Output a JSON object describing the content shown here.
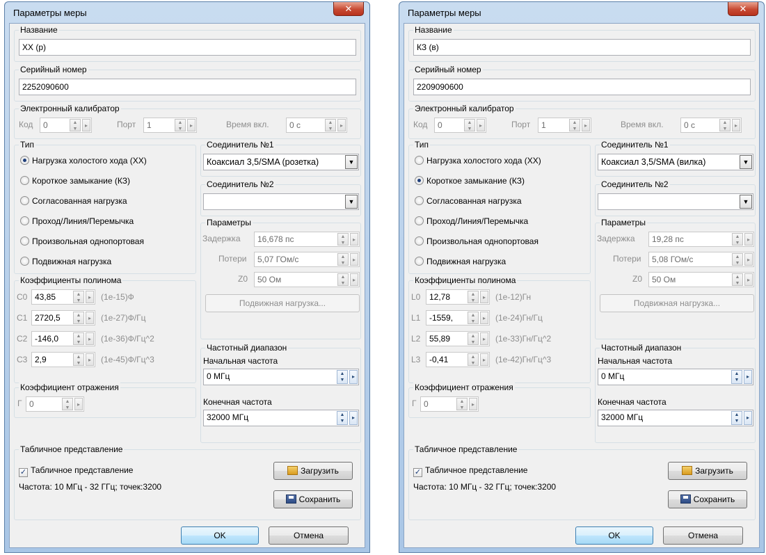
{
  "dialogs": [
    {
      "title": "Параметры меры",
      "close_glyph": "✕",
      "name_group": {
        "title": "Название",
        "value": "XX (p)"
      },
      "serial_group": {
        "title": "Серийный номер",
        "value": "2252090600"
      },
      "ecal": {
        "title": "Электронный калибратор",
        "code_label": "Код",
        "code_value": "0",
        "port_label": "Порт",
        "port_value": "1",
        "time_label": "Время вкл.",
        "time_value": "0 с"
      },
      "type": {
        "title": "Тип",
        "options": [
          "Нагрузка холостого хода (XX)",
          "Короткое замыкание (КЗ)",
          "Согласованная нагрузка",
          "Проход/Линия/Перемычка",
          "Произвольная однопортовая",
          "Подвижная нагрузка"
        ],
        "selected": 0
      },
      "conn1": {
        "title": "Соединитель №1",
        "value": "Коаксиал 3,5/SMA (розетка)"
      },
      "conn2": {
        "title": "Соединитель №2",
        "value": ""
      },
      "params": {
        "title": "Параметры",
        "delay_label": "Задержка",
        "delay_value": "16,678 пс",
        "loss_label": "Потери",
        "loss_value": "5,07 ГОм/с",
        "z0_label": "Z0",
        "z0_value": "50 Ом",
        "sliding_button": "Подвижная нагрузка..."
      },
      "poly": {
        "title": "Коэффициенты полинома",
        "rows": [
          {
            "label": "C0",
            "value": "43,85",
            "unit": "(1e-15)Ф"
          },
          {
            "label": "C1",
            "value": "2720,5",
            "unit": "(1e-27)Ф/Гц"
          },
          {
            "label": "C2",
            "value": "-146,0",
            "unit": "(1e-36)Ф/Гц^2"
          },
          {
            "label": "C3",
            "value": "2,9",
            "unit": "(1e-45)Ф/Гц^3"
          }
        ]
      },
      "reflection": {
        "title": "Коэффициент отражения",
        "label": "Г",
        "value": "0"
      },
      "freq": {
        "title": "Частотный диапазон",
        "start_label": "Начальная частота",
        "start_value": "0 МГц",
        "stop_label": "Конечная  частота",
        "stop_value": "32000 МГц"
      },
      "table": {
        "title": "Табличное представление",
        "checkbox_label": "Табличное представление",
        "checked": true,
        "info": "Частота: 10 МГц - 32 ГГц; точек:3200",
        "load_button": "Загрузить",
        "save_button": "Сохранить"
      },
      "ok_button": "OK",
      "cancel_button": "Отмена"
    },
    {
      "title": "Параметры меры",
      "close_glyph": "✕",
      "name_group": {
        "title": "Название",
        "value": "КЗ (в)"
      },
      "serial_group": {
        "title": "Серийный номер",
        "value": "2209090600"
      },
      "ecal": {
        "title": "Электронный калибратор",
        "code_label": "Код",
        "code_value": "0",
        "port_label": "Порт",
        "port_value": "1",
        "time_label": "Время вкл.",
        "time_value": "0 с"
      },
      "type": {
        "title": "Тип",
        "options": [
          "Нагрузка холостого хода (XX)",
          "Короткое замыкание (КЗ)",
          "Согласованная нагрузка",
          "Проход/Линия/Перемычка",
          "Произвольная однопортовая",
          "Подвижная нагрузка"
        ],
        "selected": 1
      },
      "conn1": {
        "title": "Соединитель №1",
        "value": "Коаксиал 3,5/SMA (вилка)"
      },
      "conn2": {
        "title": "Соединитель №2",
        "value": ""
      },
      "params": {
        "title": "Параметры",
        "delay_label": "Задержка",
        "delay_value": "19,28 пс",
        "loss_label": "Потери",
        "loss_value": "5,08 ГОм/с",
        "z0_label": "Z0",
        "z0_value": "50 Ом",
        "sliding_button": "Подвижная нагрузка..."
      },
      "poly": {
        "title": "Коэффициенты полинома",
        "rows": [
          {
            "label": "L0",
            "value": "12,78",
            "unit": "(1e-12)Гн"
          },
          {
            "label": "L1",
            "value": "-1559,",
            "unit": "(1e-24)Гн/Гц"
          },
          {
            "label": "L2",
            "value": "55,89",
            "unit": "(1e-33)Гн/Гц^2"
          },
          {
            "label": "L3",
            "value": "-0,41",
            "unit": "(1e-42)Гн/Гц^3"
          }
        ]
      },
      "reflection": {
        "title": "Коэффициент отражения",
        "label": "Г",
        "value": "0"
      },
      "freq": {
        "title": "Частотный диапазон",
        "start_label": "Начальная частота",
        "start_value": "0 МГц",
        "stop_label": "Конечная  частота",
        "stop_value": "32000 МГц"
      },
      "table": {
        "title": "Табличное представление",
        "checkbox_label": "Табличное представление",
        "checked": true,
        "info": "Частота: 10 МГц - 32 ГГц; точек:3200",
        "load_button": "Загрузить",
        "save_button": "Сохранить"
      },
      "ok_button": "OK",
      "cancel_button": "Отмена"
    }
  ],
  "icons": {
    "load": "folder-open-icon",
    "save": "floppy-disk-icon",
    "spin_up_down": "▲▼",
    "spin_arrow": "▸",
    "dropdown": "▼",
    "check": "✓"
  }
}
